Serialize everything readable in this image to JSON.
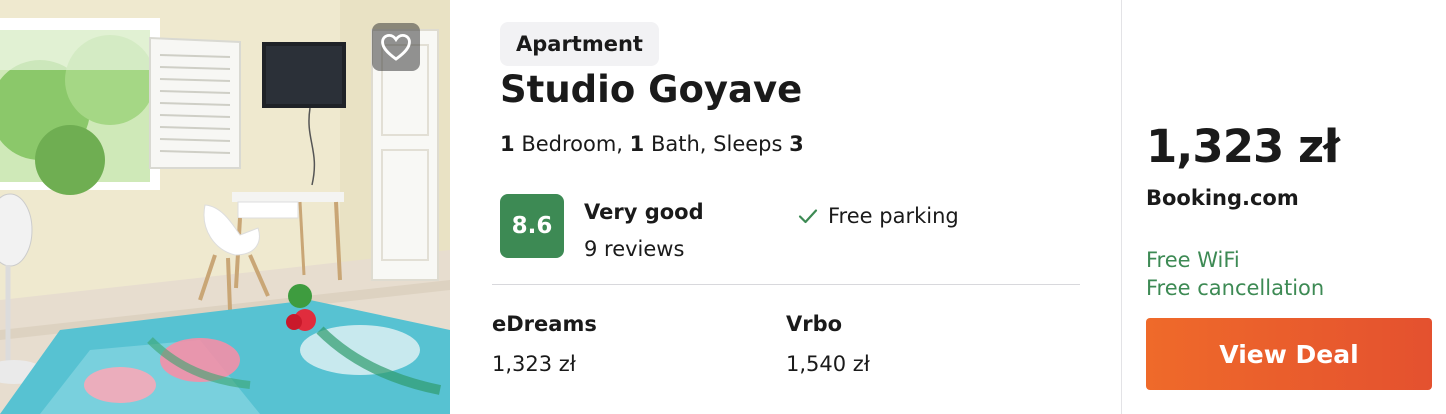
{
  "listing": {
    "type": "Apartment",
    "title": "Studio Goyave",
    "specs": {
      "bedrooms": "1",
      "bedroom_label": "Bedroom,",
      "baths": "1",
      "bath_label": "Bath, Sleeps",
      "sleeps": "3"
    },
    "rating": {
      "score": "8.6",
      "label": "Very good",
      "reviews": "9 reviews",
      "color": "#3d8a54"
    },
    "amenity": {
      "icon": "checkmark-icon",
      "label": "Free parking"
    },
    "favorite_icon": "heart-outline-icon"
  },
  "providers": [
    {
      "name": "eDreams",
      "price": "1,323 zł"
    },
    {
      "name": "Vrbo",
      "price": "1,540 zł"
    }
  ],
  "deal": {
    "price": "1,323 zł",
    "site": "Booking.com",
    "features": [
      "Free WiFi",
      "Free cancellation"
    ],
    "button_label": "View Deal",
    "accent_color": "#e85d2c"
  }
}
